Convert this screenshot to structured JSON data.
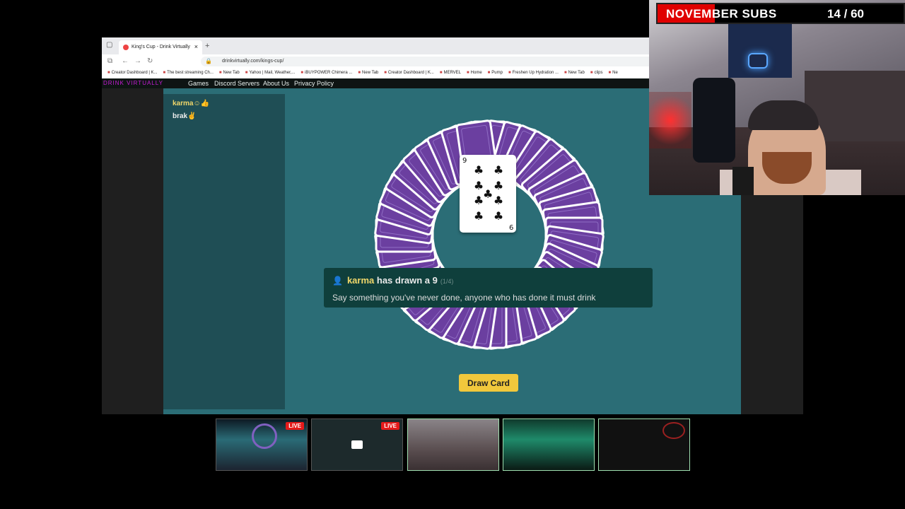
{
  "browser": {
    "tab_title": "King's Cup - Drink Virtually",
    "tab_close": "×",
    "new_tab": "+",
    "url": "drinkvirtually.com/kings-cup/",
    "bookmarks": [
      "Creator Dashboard | K...",
      "The best streaming Ch...",
      "New Tab",
      "Yahoo | Mail, Weather,...",
      "iBUYPOWER Chimera ...",
      "New Tab",
      "Creator Dashboard | K...",
      "MERVEL",
      "Home",
      "Pump",
      "Freshen Up Hydration ...",
      "New Tab",
      "clips",
      "Ne"
    ]
  },
  "site": {
    "logo": "DRINK VIRTUALLY",
    "nav": [
      "Games",
      "Discord Servers",
      "About Us",
      "Privacy Policy"
    ]
  },
  "players": [
    {
      "name": "karma☺👍",
      "active": true
    },
    {
      "name": "brak✌",
      "active": false
    }
  ],
  "card": {
    "rank": "9",
    "suit": "♣"
  },
  "message": {
    "player": "karma",
    "text": "has drawn a 9",
    "counter": "(1/4)",
    "rule": "Say something you've never done, anyone who has done it must drink"
  },
  "draw_button": "Draw Card",
  "subs_goal": {
    "label": "NOVEMBER SUBS",
    "count": "14 / 60",
    "progress": 0.233
  },
  "thumbnails": [
    {
      "name": "kings-cup-stream",
      "live": "LIVE",
      "selected": false
    },
    {
      "name": "desktop-stream",
      "live": "LIVE",
      "selected": false
    },
    {
      "name": "webcam-1",
      "live": "",
      "selected": true
    },
    {
      "name": "webcam-2",
      "live": "",
      "selected": true
    },
    {
      "name": "webcam-3",
      "live": "",
      "selected": true
    }
  ],
  "colors": {
    "table_felt": "#2b6d76",
    "card_back": "#6b3fa0",
    "accent_yellow": "#f1c83c",
    "subs_red": "#e00000"
  }
}
